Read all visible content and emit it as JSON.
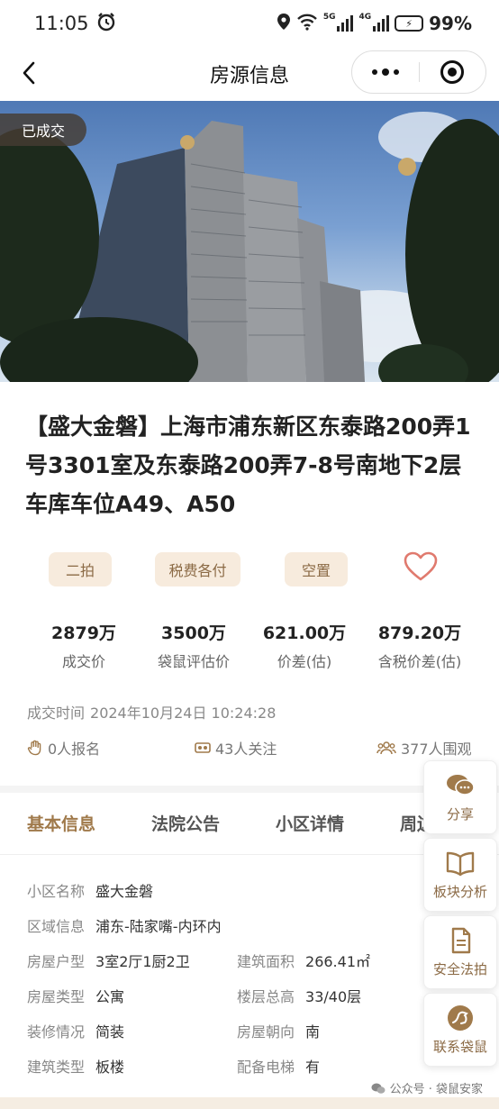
{
  "status": {
    "time": "11:05",
    "battery": "99%",
    "net1": "5G",
    "net2": "4G"
  },
  "nav": {
    "title": "房源信息"
  },
  "hero": {
    "badge": "已成交"
  },
  "property": {
    "title": "【盛大金磐】上海市浦东新区东泰路200弄1号3301室及东泰路200弄7-8号南地下2层车库车位A49、A50",
    "tags": [
      "二拍",
      "税费各付",
      "空置"
    ]
  },
  "stats": [
    {
      "value": "2879万",
      "label": "成交价"
    },
    {
      "value": "3500万",
      "label": "袋鼠评估价"
    },
    {
      "value": "621.00万",
      "label": "价差(估)"
    },
    {
      "value": "879.20万",
      "label": "含税价差(估)"
    }
  ],
  "deal_time": {
    "label": "成交时间",
    "value": "2024年10月24日 10:24:28"
  },
  "counts": {
    "signups": "0人报名",
    "follows": "43人关注",
    "viewers": "377人围观"
  },
  "tabs": [
    "基本信息",
    "法院公告",
    "小区详情",
    "周边"
  ],
  "info": [
    {
      "k": "小区名称",
      "v": "盛大金磐"
    },
    {
      "k": "区域信息",
      "v": "浦东-陆家嘴-内环内"
    },
    {
      "k": "房屋户型",
      "v": "3室2厅1厨2卫",
      "k2": "建筑面积",
      "v2": "266.41㎡"
    },
    {
      "k": "房屋类型",
      "v": "公寓",
      "k2": "楼层总高",
      "v2": "33/40层"
    },
    {
      "k": "装修情况",
      "v": "简装",
      "k2": "房屋朝向",
      "v2": "南"
    },
    {
      "k": "建筑类型",
      "v": "板楼",
      "k2": "配备电梯",
      "v2": "有"
    }
  ],
  "side": {
    "share": "分享",
    "block": "板块分析",
    "legal": "安全法拍",
    "contact": "联系袋鼠"
  },
  "watermark": "公众号 · 袋鼠安家",
  "colors": {
    "accent": "#a07a4b",
    "tag_bg": "#f7ebdd",
    "heart": "#e07a6e"
  }
}
